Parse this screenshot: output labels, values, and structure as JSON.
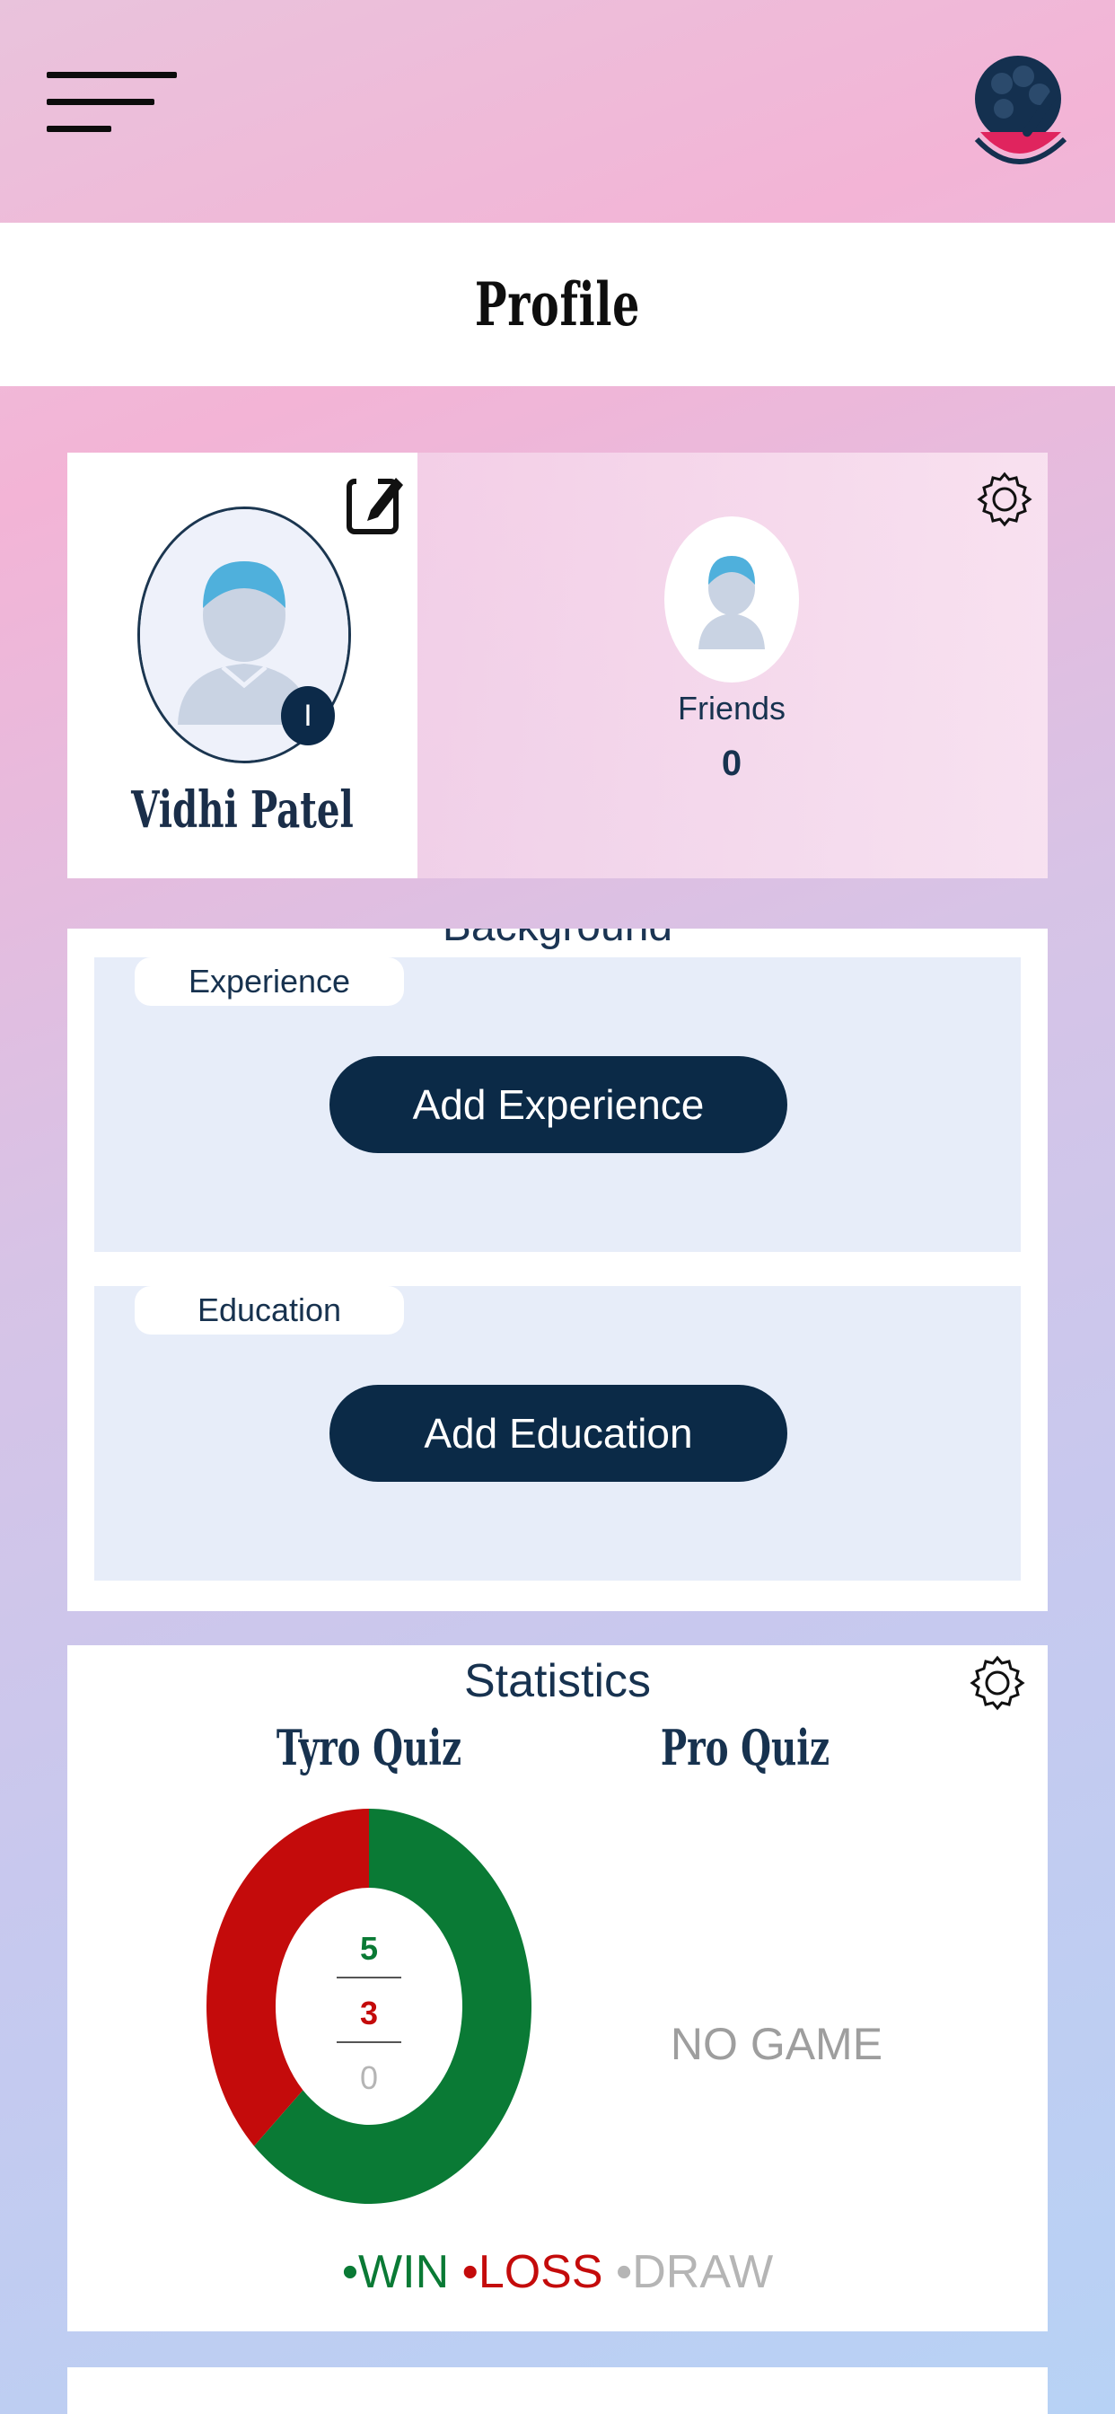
{
  "header": {
    "menu_icon": "hamburger-icon",
    "logo_icon": "brain-mortar-logo"
  },
  "page": {
    "title": "Profile"
  },
  "profile": {
    "name": "Vidhi Patel",
    "badge_letter": "I",
    "edit_icon": "edit-icon",
    "settings_icon": "gear-icon",
    "friends_label": "Friends",
    "friends_count": "0"
  },
  "background": {
    "title": "Background",
    "experience": {
      "label": "Experience",
      "button": "Add Experience"
    },
    "education": {
      "label": "Education",
      "button": "Add Education"
    }
  },
  "statistics": {
    "title": "Statistics",
    "settings_icon": "gear-icon",
    "tyro": {
      "title": "Tyro Quiz",
      "win": "5",
      "loss": "3",
      "draw": "0"
    },
    "pro": {
      "title": "Pro Quiz",
      "empty_text": "NO GAME"
    },
    "legend": {
      "win": "WIN",
      "loss": "LOSS",
      "draw": "DRAW"
    }
  },
  "colors": {
    "win": "#0a7a35",
    "loss": "#c40b0b",
    "draw": "#b5b5b5",
    "primary": "#0b2a47"
  },
  "chart_data": {
    "type": "pie",
    "title": "Tyro Quiz",
    "categories": [
      "WIN",
      "LOSS",
      "DRAW"
    ],
    "values": [
      5,
      3,
      0
    ],
    "donut": true
  }
}
